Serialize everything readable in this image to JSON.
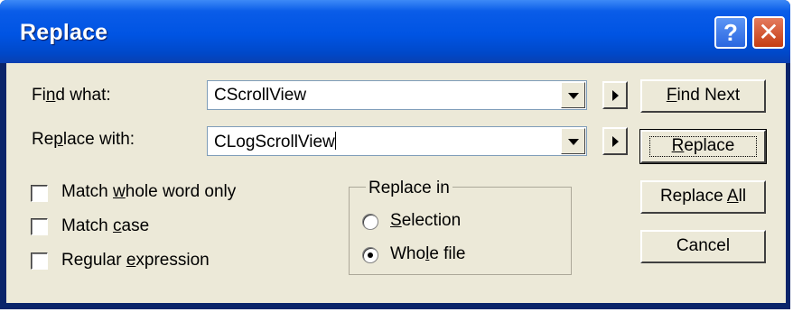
{
  "window": {
    "title": "Replace",
    "help_button": "?",
    "close_button": "✕"
  },
  "find": {
    "label_pre": "Fi",
    "label_accel": "n",
    "label_post": "d what:",
    "value": "CScrollView"
  },
  "replace": {
    "label_pre": "Re",
    "label_accel": "p",
    "label_post": "lace with:",
    "value": "CLogScrollView"
  },
  "options": {
    "whole_word": {
      "pre": "Match ",
      "accel": "w",
      "post": "hole word only",
      "checked": false
    },
    "match_case": {
      "pre": "Match ",
      "accel": "c",
      "post": "ase",
      "checked": false
    },
    "regex": {
      "pre": "Regular ",
      "accel": "e",
      "post": "xpression",
      "checked": false
    }
  },
  "replace_in": {
    "title": "Replace in",
    "selection": {
      "accel": "S",
      "post": "election",
      "selected": false
    },
    "whole_file": {
      "pre": "Who",
      "accel": "l",
      "post": "e file",
      "selected": true
    }
  },
  "buttons": {
    "find_next": {
      "accel": "F",
      "post": "ind Next"
    },
    "replace": {
      "accel": "R",
      "post": "eplace"
    },
    "replace_all": {
      "pre": "Replace ",
      "accel": "A",
      "post": "ll"
    },
    "cancel": "Cancel"
  }
}
